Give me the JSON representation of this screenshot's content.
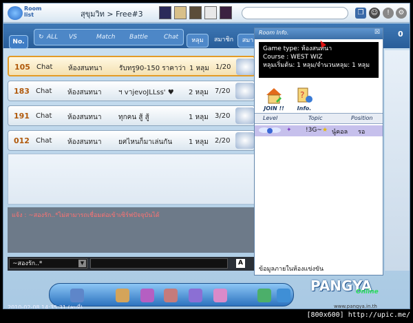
{
  "topbar": {
    "room_list_label": "Room list",
    "breadcrumb": "สุขุมวิท > Free#3"
  },
  "filter": {
    "no_label": "No.",
    "tabs": [
      "ALL",
      "VS",
      "Match",
      "Battle",
      "Chat"
    ],
    "hole_label": "หลุม",
    "member_label": "สมาชิก",
    "more_label": "สมา"
  },
  "rooms": [
    {
      "no": "105",
      "mode": "Chat",
      "type": "ห้องสนทนา",
      "title": "รับทรู90-150 ราคาว่า",
      "holes": "1 หลุม",
      "players": "1/20"
    },
    {
      "no": "183",
      "mode": "Chat",
      "type": "ห้องสนทนา",
      "title": "ฯ vาjevoJLLss' ♥",
      "holes": "2 หลุม",
      "players": "7/20"
    },
    {
      "no": "191",
      "mode": "Chat",
      "type": "ห้องสนทนา",
      "title": "ทุกคน สู้ สู้",
      "holes": "1 หลุม",
      "players": "3/20"
    },
    {
      "no": "012",
      "mode": "Chat",
      "type": "ห้องสนทนา",
      "title": "ยศไหนก็มาเล่นกัน",
      "holes": "1 หลุม",
      "players": "2/20"
    }
  ],
  "chat": {
    "message": "แจ้ง : ~สองรัก..*ไม่สามารถเชื่อมต่อเข้าเซิร์ฟปัจจุบันได้",
    "target": "~สองรัก..*",
    "font_label": "A"
  },
  "room_info": {
    "title": "Room Info.",
    "close": "☒",
    "desc_lines": [
      "Game type: ห้องสนทนา",
      "Course : WEST WIZ",
      "หลุมเริ่มต้น: 1 หลุม/จำนวนหลุม: 1 หลุม"
    ],
    "join_label": "JOIN !!",
    "info_label": "Info.",
    "columns": [
      "Level",
      "Topic",
      "Position"
    ],
    "player": {
      "topic": "!3G~",
      "name": "นู๋คอล",
      "position": "รอ"
    },
    "footer": "ข้อมูลภายในห้องแข่งขัน"
  },
  "right_counter": "0",
  "logo": {
    "main": "PANGYA",
    "sub": "Online"
  },
  "site_url": "www.pangya.in.th",
  "timestamp": "2010-02-08 14:35:31 (ลบที่)",
  "watermark": "[800x600] http://upic.me/",
  "colors": {
    "accent": "#2d73bf",
    "selected_border": "#e39b25",
    "chat_warning": "#ff7272"
  }
}
